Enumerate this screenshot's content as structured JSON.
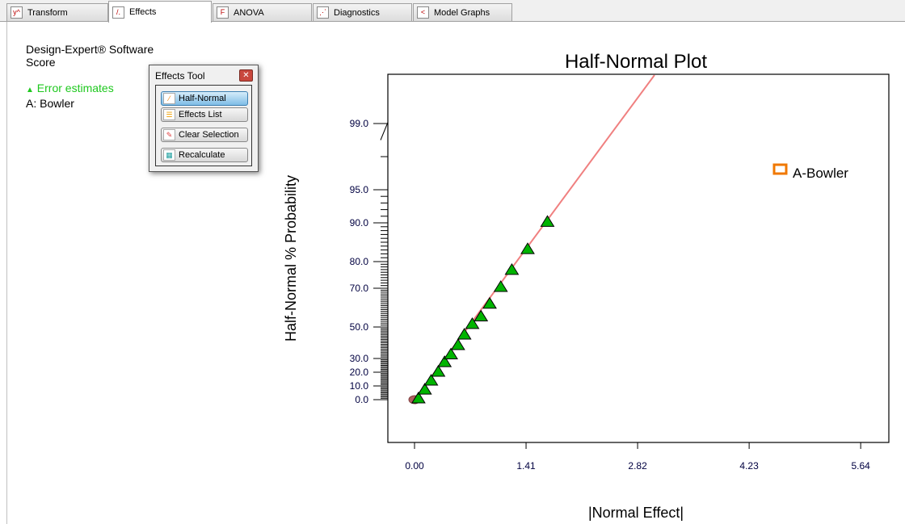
{
  "tabs": [
    {
      "label": "Transform",
      "icon": "transform-icon"
    },
    {
      "label": "Effects",
      "icon": "effects-icon",
      "active": true
    },
    {
      "label": "ANOVA",
      "icon": "anova-icon"
    },
    {
      "label": "Diagnostics",
      "icon": "diagnostics-icon"
    },
    {
      "label": "Model Graphs",
      "icon": "model-graphs-icon"
    }
  ],
  "info": {
    "software": "Design-Expert® Software",
    "response": "Score",
    "error_estimates": "Error estimates",
    "factor": "A: Bowler"
  },
  "effects_tool": {
    "title": "Effects Tool",
    "buttons": [
      "Half-Normal",
      "Effects List",
      "Clear Selection",
      "Recalculate"
    ],
    "selected": "Half-Normal"
  },
  "chart_data": {
    "type": "scatter",
    "title": "Half-Normal Plot",
    "xlabel": "|Normal Effect|",
    "ylabel": "Half-Normal % Probability",
    "xticks": [
      "0.00",
      "1.41",
      "2.82",
      "4.23",
      "5.64"
    ],
    "yticks": [
      "0.0",
      "10.0",
      "20.0",
      "30.0",
      "50.0",
      "70.0",
      "80.0",
      "90.0",
      "95.0",
      "99.0"
    ],
    "legend": {
      "label": "A-Bowler",
      "position": "right",
      "color": "#f07800"
    },
    "series": [
      {
        "marker": "triangle",
        "color": "#00b400",
        "x": [
          0.05,
          0.13,
          0.21,
          0.3,
          0.38,
          0.46,
          0.55,
          0.63,
          0.73,
          0.84,
          0.95,
          1.09,
          1.23,
          1.43,
          1.68
        ],
        "y": [
          1.2,
          7.6,
          14.1,
          20.6,
          27.6,
          32.8,
          38.7,
          45.4,
          51.7,
          55.6,
          62.2,
          70.6,
          77,
          83.3,
          90.2
        ]
      },
      {
        "marker": "circle",
        "color": "#b06060",
        "x": [
          0.0
        ],
        "y": [
          0.0
        ]
      }
    ],
    "fit_line": {
      "color": "#f08080"
    },
    "grid": false
  }
}
